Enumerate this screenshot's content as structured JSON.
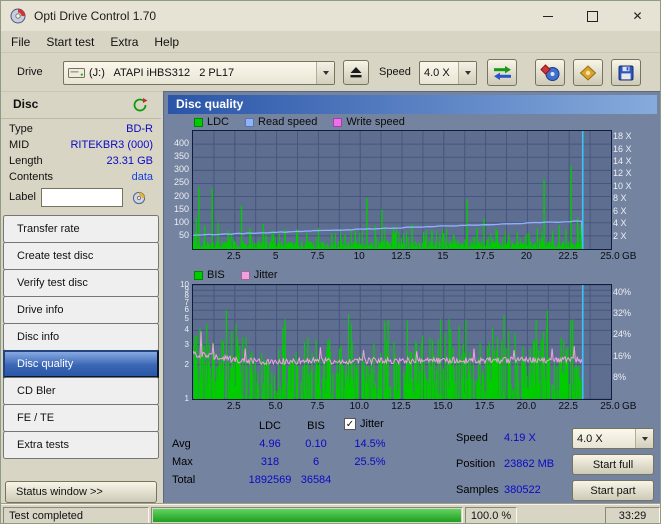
{
  "window": {
    "title": "Opti Drive Control 1.70"
  },
  "icons": {
    "close": "✕",
    "check": "✓"
  },
  "menubar": {
    "items": [
      "File",
      "Start test",
      "Extra",
      "Help"
    ]
  },
  "toolbar": {
    "drive_label": "Drive",
    "drive_value": "(J:)   ATAPI iHBS312   2 PL17",
    "speed_label": "Speed",
    "speed_value": "4.0 X"
  },
  "sidebar": {
    "header": "Disc",
    "fields": [
      {
        "label": "Type",
        "value": "BD-R"
      },
      {
        "label": "MID",
        "value": "RITEKBR3 (000)"
      },
      {
        "label": "Length",
        "value": "23.31 GB"
      },
      {
        "label": "Contents",
        "value": "data",
        "link": true
      }
    ],
    "label_field": {
      "label": "Label",
      "value": ""
    },
    "nav": [
      "Transfer rate",
      "Create test disc",
      "Verify test disc",
      "Drive info",
      "Disc info",
      "Disc quality",
      "CD Bler",
      "FE / TE",
      "Extra tests"
    ],
    "active_nav": "Disc quality",
    "status_window_button": "Status window >>"
  },
  "main": {
    "header": "Disc quality"
  },
  "results": {
    "col_ldc": "LDC",
    "col_bis": "BIS",
    "jitter_checkbox": "Jitter",
    "rows": [
      {
        "label": "Avg",
        "ldc": "4.96",
        "bis": "0.10",
        "jitter": "14.5%"
      },
      {
        "label": "Max",
        "ldc": "318",
        "bis": "6",
        "jitter": "25.5%"
      },
      {
        "label": "Total",
        "ldc": "1892569",
        "bis": "36584",
        "jitter": ""
      }
    ],
    "speed_label": "Speed",
    "speed_value": "4.19 X",
    "speed_select": "4.0 X",
    "position_label": "Position",
    "position_value": "23862 MB",
    "samples_label": "Samples",
    "samples_value": "380522",
    "start_full": "Start full",
    "start_part": "Start part"
  },
  "statusbar": {
    "status": "Test completed",
    "progress_pct": 100.0,
    "progress_text": "100.0 %",
    "time": "33:29"
  },
  "chart_data": [
    {
      "name": "disc-quality-ldc-read-speed",
      "type": "bar",
      "legend": [
        {
          "label": "LDC",
          "color": "#00cc00"
        },
        {
          "label": "Read speed",
          "color": "#8fb2ff"
        },
        {
          "label": "Write speed",
          "color": "#f06cf0"
        }
      ],
      "x_axis": {
        "tick_labels": [
          "2.5",
          "5",
          "7.5",
          "10",
          "12.5",
          "15",
          "17.5",
          "20",
          "22.5",
          "25.0"
        ],
        "tick_values": [
          2.5,
          5,
          7.5,
          10,
          12.5,
          15,
          17.5,
          20,
          22.5,
          25
        ],
        "unit": "GB",
        "max_gb": 25.0
      },
      "y_left": {
        "ticks": [
          50,
          100,
          150,
          200,
          250,
          300,
          350,
          400
        ],
        "max": 450
      },
      "y_right": {
        "tick_labels": [
          "2 X",
          "4 X",
          "6 X",
          "8 X",
          "10 X",
          "12 X",
          "14 X",
          "16 X",
          "18 X"
        ],
        "tick_values": [
          2,
          4,
          6,
          8,
          10,
          12,
          14,
          16,
          18
        ],
        "max": 19
      },
      "data_end_gb": 23.31,
      "ldc": {
        "avg": 4.96,
        "max": 318,
        "total": 1892569,
        "baseline_max": 40,
        "spikes": [
          [
            0.2,
            120
          ],
          [
            0.35,
            235
          ],
          [
            0.7,
            90
          ],
          [
            1.15,
            230
          ],
          [
            1.5,
            100
          ],
          [
            2.1,
            70
          ],
          [
            2.9,
            165
          ],
          [
            3.4,
            80
          ],
          [
            4.2,
            95
          ],
          [
            4.8,
            60
          ],
          [
            5.5,
            70
          ],
          [
            6.2,
            75
          ],
          [
            6.8,
            55
          ],
          [
            7.5,
            80
          ],
          [
            8.3,
            60
          ],
          [
            9.1,
            55
          ],
          [
            9.7,
            70
          ],
          [
            10.4,
            195
          ],
          [
            10.9,
            90
          ],
          [
            11.3,
            150
          ],
          [
            12.0,
            85
          ],
          [
            12.6,
            60
          ],
          [
            13.1,
            95
          ],
          [
            13.8,
            65
          ],
          [
            14.3,
            70
          ],
          [
            15.0,
            60
          ],
          [
            15.6,
            55
          ],
          [
            16.4,
            190
          ],
          [
            17.0,
            80
          ],
          [
            17.4,
            115
          ],
          [
            18.2,
            70
          ],
          [
            18.9,
            55
          ],
          [
            19.4,
            65
          ],
          [
            20.1,
            60
          ],
          [
            20.6,
            80
          ],
          [
            21.0,
            265
          ],
          [
            21.5,
            70
          ],
          [
            21.9,
            90
          ],
          [
            22.3,
            75
          ],
          [
            22.6,
            318
          ],
          [
            23.0,
            120
          ],
          [
            23.2,
            90
          ]
        ]
      },
      "read_speed": {
        "start_x": 2.2,
        "end_x": 4.5
      }
    },
    {
      "name": "disc-quality-bis-jitter",
      "type": "bar",
      "legend": [
        {
          "label": "BIS",
          "color": "#00cc00"
        },
        {
          "label": "Jitter",
          "color": "#f0a0e0"
        }
      ],
      "x_axis": {
        "tick_labels": [
          "2.5",
          "5.0",
          "7.5",
          "10.0",
          "12.5",
          "15.0",
          "17.5",
          "20.0",
          "22.5",
          "25.0"
        ],
        "tick_values": [
          2.5,
          5,
          7.5,
          10,
          12.5,
          15,
          17.5,
          20,
          22.5,
          25
        ],
        "unit": "GB",
        "max_gb": 25.0
      },
      "y_left": {
        "scale": "log",
        "ticks": [
          10,
          9,
          8,
          7,
          6,
          5,
          4,
          3,
          2,
          1
        ]
      },
      "y_right": {
        "tick_labels": [
          "40%",
          "32%",
          "24%",
          "16%",
          "8%"
        ],
        "tick_values": [
          40,
          32,
          24,
          16,
          8
        ],
        "max": 43
      },
      "data_end_gb": 23.31,
      "bis": {
        "avg": 0.1,
        "max": 6,
        "total": 36584,
        "spikes": [
          [
            2.0,
            6
          ],
          [
            5.5,
            5
          ],
          [
            9.3,
            5.5
          ],
          [
            14.8,
            5
          ],
          [
            18.6,
            5.5
          ],
          [
            21.2,
            6
          ],
          [
            22.7,
            5
          ]
        ]
      },
      "jitter": {
        "avg_pct": 14.5,
        "max_pct": 25.5,
        "spikes": [
          [
            0.5,
            25.5
          ],
          [
            1.2,
            21
          ],
          [
            3.1,
            19
          ],
          [
            7.6,
            19.5
          ],
          [
            10.2,
            18.5
          ],
          [
            13.4,
            18
          ],
          [
            16.8,
            19
          ],
          [
            19.2,
            18.5
          ],
          [
            21.5,
            19
          ],
          [
            22.8,
            20
          ]
        ]
      }
    }
  ]
}
